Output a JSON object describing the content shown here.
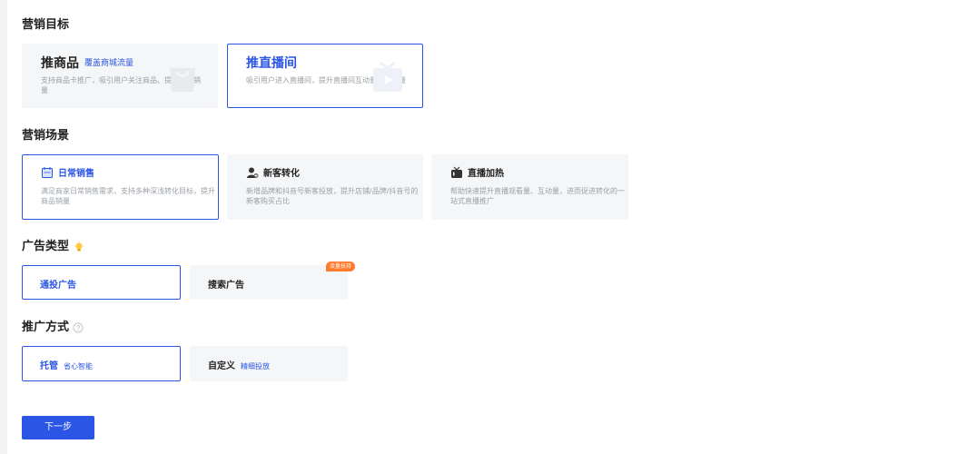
{
  "marketing_goal": {
    "title": "营销目标",
    "options": [
      {
        "title": "推商品",
        "tag": "覆盖商城流量",
        "desc": "支持商品卡推广，吸引用户关注商品、提升商品销量",
        "selected": false
      },
      {
        "title": "推直播间",
        "tag": "",
        "desc": "吸引用户进入直播间，提升直播间互动量和成交量",
        "selected": true
      }
    ]
  },
  "marketing_scene": {
    "title": "营销场景",
    "options": [
      {
        "title": "日常销售",
        "icon": "calendar-icon",
        "desc": "满足商家日常销售需求，支持多种深浅转化目标，提升商品销量",
        "selected": true
      },
      {
        "title": "新客转化",
        "icon": "user-add-icon",
        "desc": "新增品牌和抖音号新客投放，提升店铺/品牌/抖音号的新客购买占比",
        "selected": false
      },
      {
        "title": "直播加热",
        "icon": "live-tv-icon",
        "desc": "帮助快速提升直播观看量、互动量，进而促进转化的一站式直播推广",
        "selected": false
      }
    ]
  },
  "ad_type": {
    "title": "广告类型",
    "icon": "lightbulb-icon",
    "options": [
      {
        "label": "通投广告",
        "selected": true,
        "badge": ""
      },
      {
        "label": "搜索广告",
        "selected": false,
        "badge": "流量扶持"
      }
    ]
  },
  "promo_method": {
    "title": "推广方式",
    "icon": "help-icon",
    "options": [
      {
        "label": "托管",
        "sub": "省心智能",
        "selected": true
      },
      {
        "label": "自定义",
        "sub": "精细投放",
        "selected": false
      }
    ]
  },
  "next_button": "下一步",
  "colors": {
    "accent": "#2a55e5",
    "card_bg": "#f5f6f8",
    "badge": "#ff7a2e"
  }
}
